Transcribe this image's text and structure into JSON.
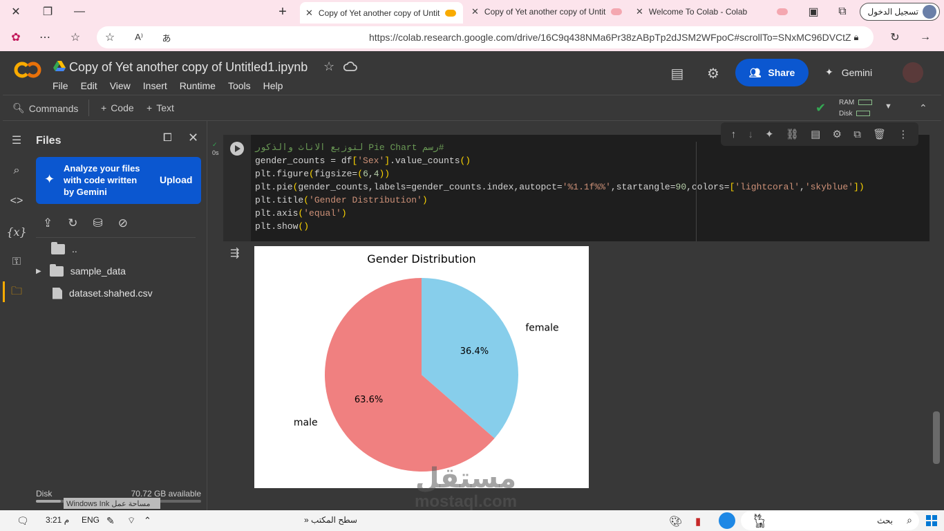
{
  "browser": {
    "tabs": [
      {
        "title": "Copy of Yet another copy of Untit",
        "active": true
      },
      {
        "title": "Copy of Yet another copy of Untit",
        "active": false
      },
      {
        "title": "Welcome To Colab - Colab",
        "active": false
      }
    ],
    "signin_label": "تسجيل الدخول",
    "url": "https://colab.research.google.com/drive/16C9q438NMa6Pr38zABpTp2dJSM2WFpoC#scrollTo=SNxMC96DVCtZ"
  },
  "colab": {
    "notebook_title": "Copy of Yet another copy of Untitled1.ipynb",
    "menu": [
      "File",
      "Edit",
      "View",
      "Insert",
      "Runtime",
      "Tools",
      "Help"
    ],
    "share_label": "Share",
    "gemini_label": "Gemini",
    "toolbar": {
      "commands_label": "Commands",
      "code_label": "Code",
      "text_label": "Text",
      "ram_label": "RAM",
      "disk_label": "Disk"
    }
  },
  "files_panel": {
    "title": "Files",
    "gemini_card_text": "Analyze your files with code written by Gemini",
    "upload_label": "Upload",
    "items": [
      {
        "name": "..",
        "type": "folder"
      },
      {
        "name": "sample_data",
        "type": "folder"
      },
      {
        "name": "dataset.shahed.csv",
        "type": "file"
      }
    ],
    "disk_label": "Disk",
    "disk_available": "70.72 GB available",
    "disk_fraction_used": 0.15
  },
  "cell": {
    "exec_time": "0s",
    "code": {
      "comment": "#رسم Pie Chart لتوزيع الاناث والذكور",
      "l1a": "gender_counts = df",
      "l1b": "[",
      "l1c": "'Sex'",
      "l1d": "]",
      "l1e": ".value_counts",
      "l1f": "()",
      "l2a": "plt.figure",
      "l2b": "(",
      "l2c": "figsize=",
      "l2d": "(",
      "l2e": "6",
      "l2f": ",",
      "l2g": "4",
      "l2h": "))",
      "l3a": "plt.pie",
      "l3b": "(",
      "l3c": "gender_counts,labels=gender_counts.index,autopct=",
      "l3d": "'%1.1f%%'",
      "l3e": ",startangle=",
      "l3f": "90",
      "l3g": ",colors=",
      "l3h": "[",
      "l3i": "'lightcoral'",
      "l3j": ",",
      "l3k": "'skyblue'",
      "l3l": "])",
      "l4a": "plt.title",
      "l4b": "(",
      "l4c": "'Gender Distribution'",
      "l4d": ")",
      "l5a": "plt.axis",
      "l5b": "(",
      "l5c": "'equal'",
      "l5d": ")",
      "l6a": "plt.show",
      "l6b": "()"
    }
  },
  "chart_data": {
    "type": "pie",
    "title": "Gender Distribution",
    "categories": [
      "male",
      "female"
    ],
    "values": [
      63.6,
      36.4
    ],
    "value_labels": [
      "63.6%",
      "36.4%"
    ],
    "colors": [
      "#f08080",
      "#87ceeb"
    ],
    "startangle": 90
  },
  "taskbar": {
    "time": "3:21 م",
    "lang": "ENG",
    "desktop_label": "سطح المكتب",
    "search_placeholder": "بحث",
    "ink_label": "Windows Ink مساحة عمل"
  },
  "watermark": {
    "arabic": "مستقل",
    "latin": "mostaql.com"
  }
}
